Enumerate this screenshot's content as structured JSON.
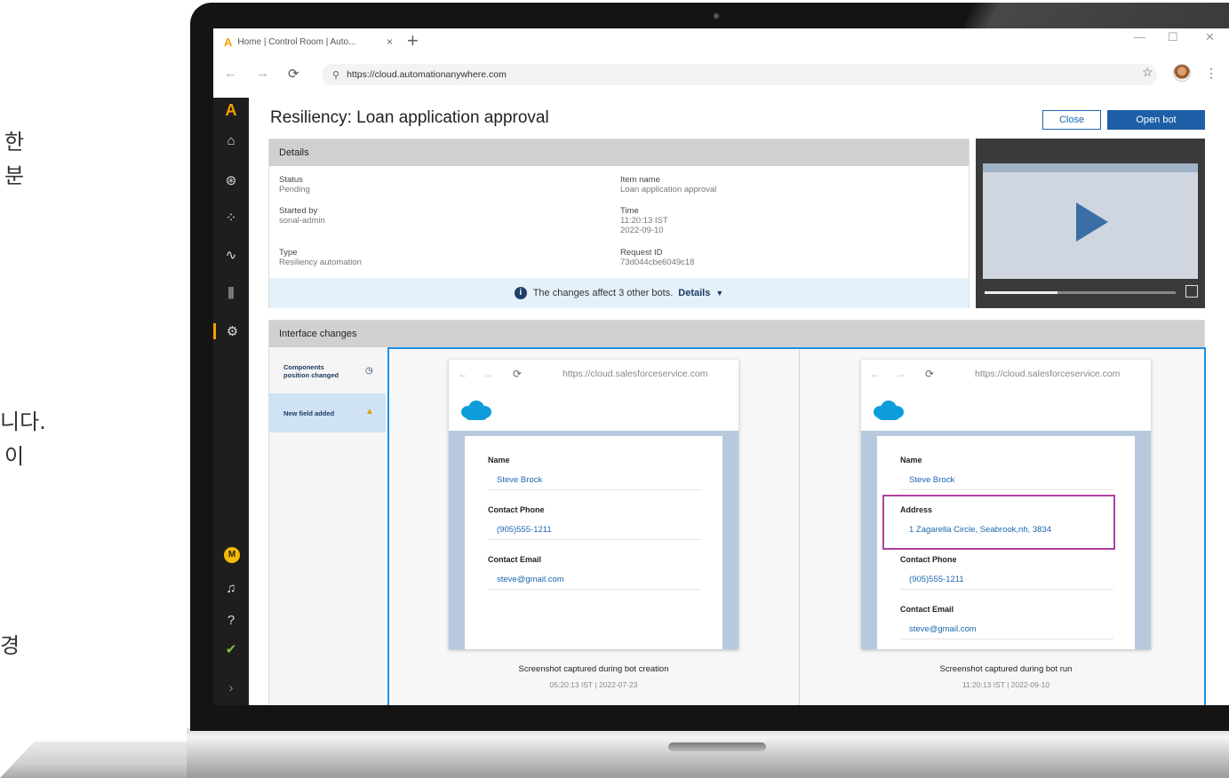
{
  "left_text": [
    "한",
    "분",
    "니다.",
    "이",
    "경"
  ],
  "browser": {
    "tab_title": "Home | Control Room | Auto...",
    "tab_close": "×",
    "new_tab": "+",
    "url": "https://cloud.automationanywhere.com"
  },
  "sidebar": {
    "logo": "A",
    "user_initial": "M"
  },
  "page": {
    "title": "Resiliency: Loan application approval",
    "close_label": "Close",
    "open_label": "Open bot"
  },
  "details": {
    "heading": "Details",
    "status_label": "Status",
    "status_value": "Pending",
    "started_label": "Started by",
    "started_value": "sonal-admin",
    "type_label": "Type",
    "type_value": "Resiliency automation",
    "item_label": "Item name",
    "item_value": "Loan application approval",
    "time_label": "Time",
    "time_value1": "11:20:13 IST",
    "time_value2": "2022-09-10",
    "request_label": "Request ID",
    "request_value": "73d044cbe6049c18",
    "notice_text": "The changes affect 3 other bots.",
    "notice_link": "Details"
  },
  "video": {
    "progress": 0.38
  },
  "interface_changes": {
    "heading": "Interface changes",
    "items": [
      {
        "line1": "Components",
        "line2": "position changed"
      },
      {
        "line1": "New field added",
        "line2": ""
      }
    ],
    "left_shot": {
      "url": "https://cloud.salesforceservice.com",
      "fields": [
        {
          "label": "Name",
          "value": "Steve Brock"
        },
        {
          "label": "Contact Phone",
          "value": "(905)555-1211"
        },
        {
          "label": "Contact Email",
          "value": "steve@gmail.com"
        }
      ],
      "caption": "Screenshot captured during bot creation",
      "timestamp": "05:20:13 IST | 2022-07-23"
    },
    "right_shot": {
      "url": "https://cloud.salesforceservice.com",
      "fields": [
        {
          "label": "Name",
          "value": "Steve Brock"
        },
        {
          "label": "Address",
          "value": "1 Zagarella Circle, Seabrook,nh, 3834"
        },
        {
          "label": "Contact Phone",
          "value": "(905)555-1211"
        },
        {
          "label": "Contact Email",
          "value": "steve@gmail.com"
        }
      ],
      "caption": "Screenshot captured during bot run",
      "timestamp": "11:20:13 IST | 2022-09-10"
    }
  },
  "colors": {
    "accent": "#f5a000",
    "primary": "#1d5fa6",
    "highlight": "#b03f9e",
    "selection": "#1e90e6"
  }
}
